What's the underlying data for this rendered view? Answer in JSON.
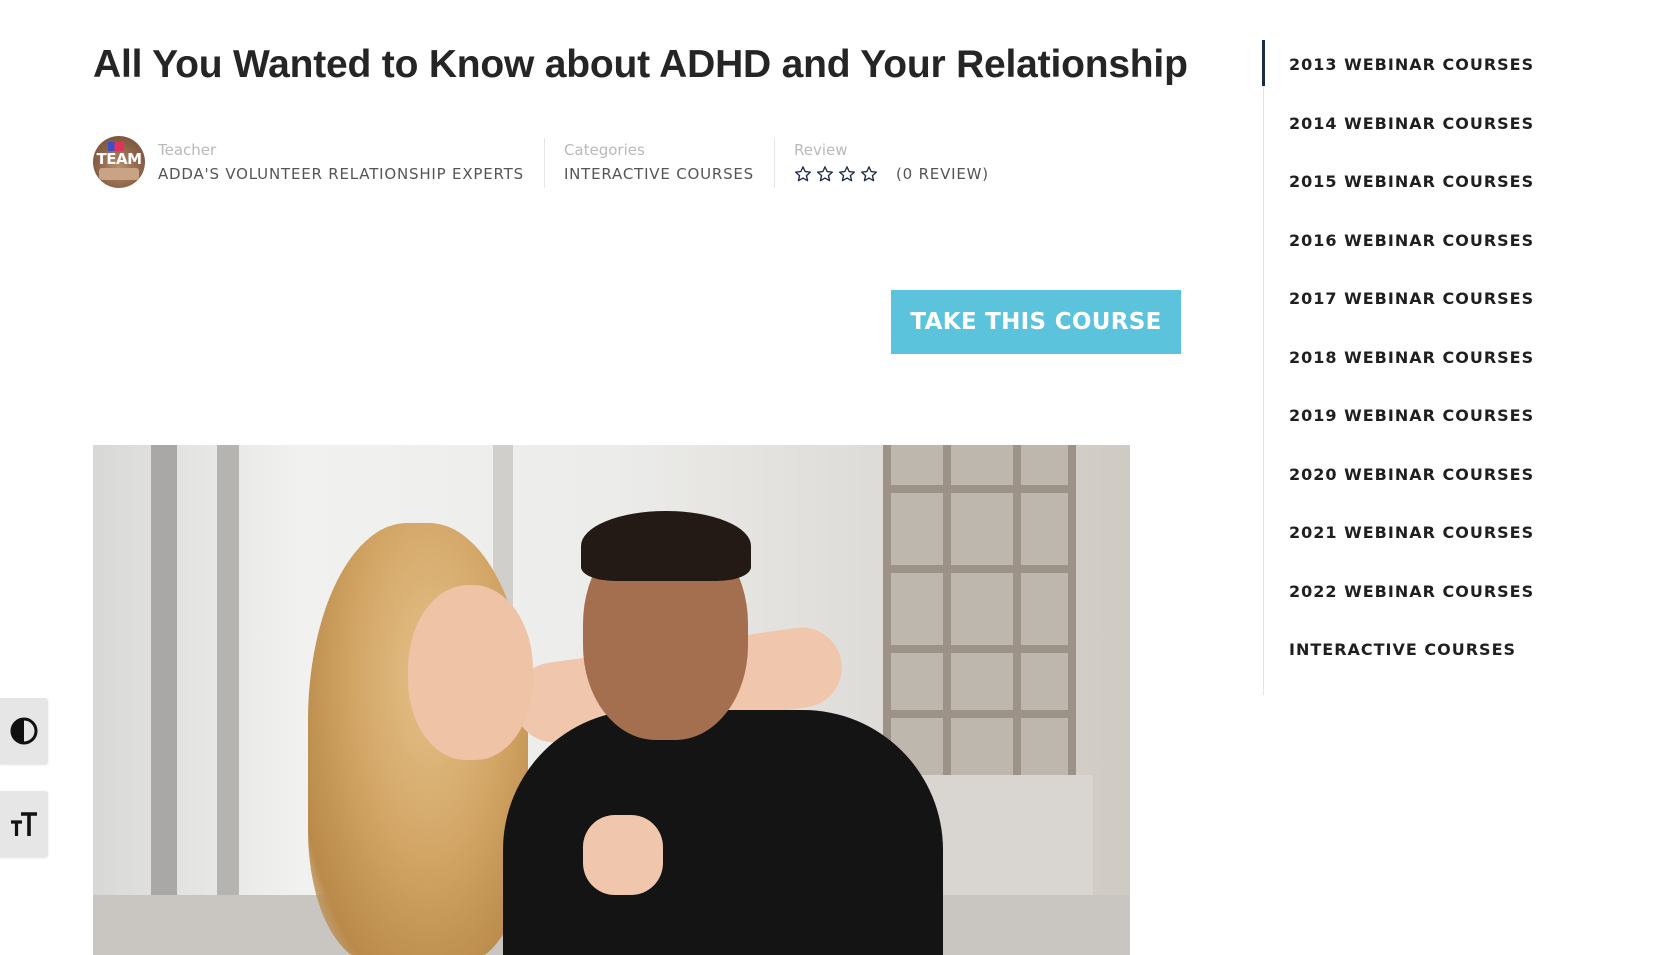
{
  "course": {
    "title": "All You Wanted to Know about ADHD and Your Relationship",
    "teacher_label": "Teacher",
    "teacher_value": "ADDA'S VOLUNTEER RELATIONSHIP EXPERTS",
    "categories_label": "Categories",
    "categories_value": "INTERACTIVE COURSES",
    "review_label": "Review",
    "review_count": "(0 REVIEW)",
    "rating": 0,
    "rating_max": 4,
    "cta_label": "TAKE THIS COURSE",
    "avatar_text": "TEAM"
  },
  "colors": {
    "cta": "#5bc4dc",
    "sidebar_active": "#1d2b4a",
    "title": "#252525"
  },
  "sidebar": {
    "items": [
      {
        "label": "2013 WEBINAR COURSES"
      },
      {
        "label": "2014 WEBINAR COURSES"
      },
      {
        "label": "2015 WEBINAR COURSES"
      },
      {
        "label": "2016 WEBINAR COURSES"
      },
      {
        "label": "2017 WEBINAR COURSES"
      },
      {
        "label": "2018 WEBINAR COURSES"
      },
      {
        "label": "2019 WEBINAR COURSES"
      },
      {
        "label": "2020 WEBINAR COURSES"
      },
      {
        "label": "2021 WEBINAR COURSES"
      },
      {
        "label": "2022 WEBINAR COURSES"
      },
      {
        "label": "INTERACTIVE COURSES"
      }
    ]
  },
  "toolbar": {
    "contrast_icon": "contrast-icon",
    "fontsize_icon": "font-size-icon"
  }
}
